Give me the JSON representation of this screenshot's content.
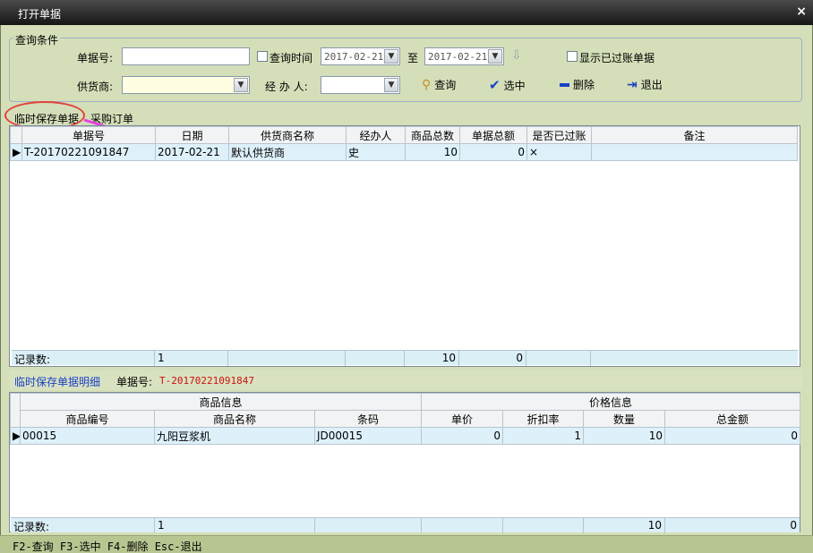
{
  "window": {
    "title": "打开单据",
    "close": "×"
  },
  "query": {
    "group_title": "查询条件",
    "doc_no_label": "单据号:",
    "doc_no_value": "",
    "query_time_label": "查询时间",
    "date_from": "2017-02-21",
    "to_label": "至",
    "date_to": "2017-02-21",
    "show_posted_label": "显示已过账单据",
    "supplier_label": "供货商:",
    "supplier_value": "",
    "operator_label": "经 办 人:",
    "operator_value": "",
    "btn_query": "查询",
    "btn_select": "选中",
    "btn_delete": "删除",
    "btn_exit": "退出"
  },
  "tabs": [
    {
      "label": "临时保存单据",
      "active": true
    },
    {
      "label": "采购订单",
      "active": false
    }
  ],
  "main_grid": {
    "columns": [
      "单据号",
      "日期",
      "供货商名称",
      "经办人",
      "商品总数",
      "单据总额",
      "是否已过账",
      "备注"
    ],
    "rows": [
      {
        "doc_no": "T-20170221091847",
        "date": "2017-02-21",
        "supplier": "默认供货商",
        "operator": "史",
        "qty": "10",
        "amount": "0",
        "posted": "×",
        "note": ""
      }
    ],
    "footer": {
      "label": "记录数:",
      "count": "1",
      "qty": "10",
      "amount": "0"
    }
  },
  "detail": {
    "title": "临时保存单据明细",
    "doc_label": "单据号:",
    "doc_value": "T-20170221091847",
    "group_product": "商品信息",
    "group_price": "价格信息",
    "columns": [
      "商品编号",
      "商品名称",
      "条码",
      "单价",
      "折扣率",
      "数量",
      "总金额"
    ],
    "rows": [
      {
        "code": "00015",
        "name": "九阳豆浆机",
        "barcode": "JD00015",
        "price": "0",
        "discount": "1",
        "qty": "10",
        "total": "0"
      }
    ],
    "footer": {
      "label": "记录数:",
      "count": "1",
      "qty": "10",
      "total": "0"
    }
  },
  "statusbar": {
    "text": "F2-查询 F3-选中 F4-删除 Esc-退出"
  },
  "colors": {
    "accent_blue": "#1a3fc4",
    "doc_red": "#d01010",
    "annotation": "#e0443a",
    "arrow": "#e83fe0"
  }
}
